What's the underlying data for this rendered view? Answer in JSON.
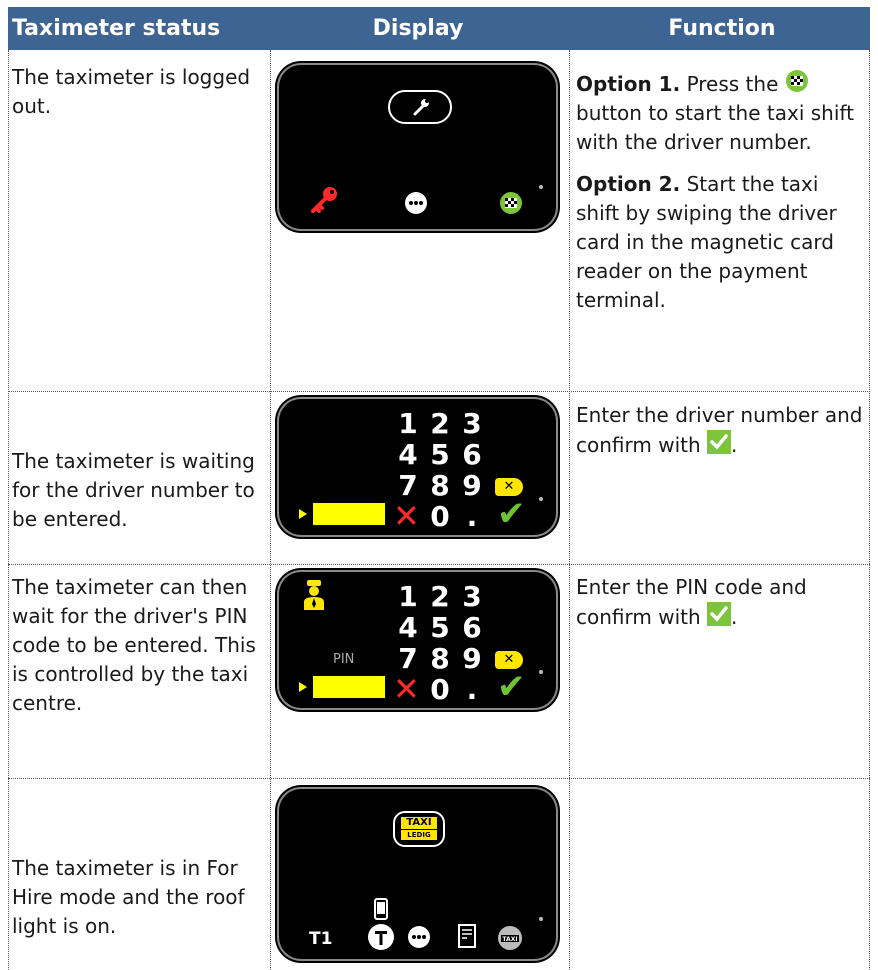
{
  "header": {
    "col1": "Taximeter status",
    "col2": "Display",
    "col3": "Function"
  },
  "rows": [
    {
      "status": "The taximeter is logged out.",
      "function": {
        "p1_bold": "Option 1.",
        "p1_a": "Press the",
        "p1_b": "button to start the taxi shift with the driver number.",
        "p2_bold": "Option 2.",
        "p2_text": "Start the taxi shift by swiping the driver card in the magnetic card reader on the payment terminal."
      }
    },
    {
      "status": "The taximeter is waiting for the driver number to be entered.",
      "function": {
        "text": "Enter the driver number and confirm with",
        "end": "."
      }
    },
    {
      "status": "The taximeter can then wait for the driver's PIN code to be entered. This is controlled by the taxi centre.",
      "function": {
        "text": "Enter the PIN code and confirm with",
        "end": "."
      }
    },
    {
      "status": "The taximeter is in For Hire mode and the roof light is on.",
      "function": {
        "text": ""
      }
    }
  ],
  "keypad": {
    "row1": [
      "1",
      "2",
      "3"
    ],
    "row2": [
      "4",
      "5",
      "6"
    ],
    "row3": [
      "7",
      "8",
      "9"
    ],
    "zero": "0",
    "dot": "."
  },
  "pin_label": "PIN",
  "taxi_sign": {
    "top": "TAXI",
    "bottom": "LEDIG"
  },
  "tariff_label": "T1",
  "icons": {
    "wrench": "wrench-icon",
    "key": "key-icon",
    "more": "more-icon",
    "checkered_flag": "checkered-flag-icon",
    "driver": "driver-icon",
    "phone": "phone-icon",
    "receipt": "receipt-icon",
    "taxi_roof": "taxi-roof-icon",
    "t_circle": "t-circle-icon"
  },
  "colors": {
    "header_bg": "#3e6494",
    "yellow": "#ffff00",
    "red": "#ff2a2a",
    "green": "#6cc433"
  }
}
